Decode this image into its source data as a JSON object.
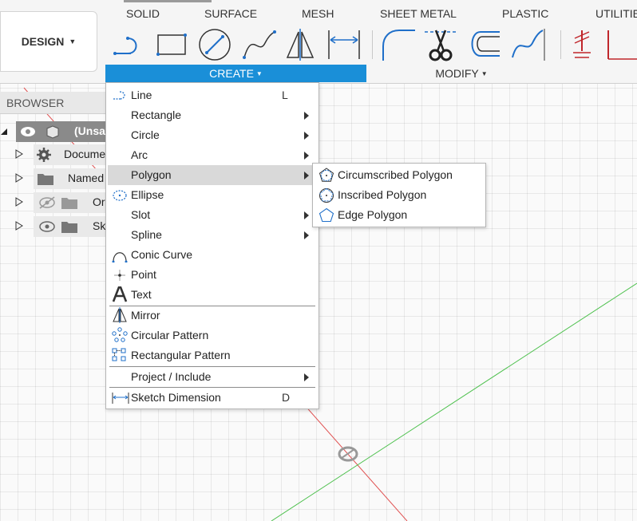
{
  "toolbar": {
    "workspace": "DESIGN",
    "tabs": [
      "SOLID",
      "SURFACE",
      "MESH",
      "SHEET METAL",
      "PLASTIC",
      "UTILITIES"
    ],
    "create_label": "CREATE",
    "modify_label": "MODIFY"
  },
  "browser": {
    "title": "BROWSER",
    "items": [
      {
        "label": "(Unsaved)"
      },
      {
        "label": "Document Settings"
      },
      {
        "label": "Named Views"
      },
      {
        "label": "Origin"
      },
      {
        "label": "Sketches"
      }
    ]
  },
  "create_menu": {
    "items": [
      {
        "label": "Line",
        "shortcut": "L"
      },
      {
        "label": "Rectangle"
      },
      {
        "label": "Circle"
      },
      {
        "label": "Arc"
      },
      {
        "label": "Polygon"
      },
      {
        "label": "Ellipse"
      },
      {
        "label": "Slot"
      },
      {
        "label": "Spline"
      },
      {
        "label": "Conic Curve"
      },
      {
        "label": "Point"
      },
      {
        "label": "Text"
      },
      {
        "label": "Mirror"
      },
      {
        "label": "Circular Pattern"
      },
      {
        "label": "Rectangular Pattern"
      },
      {
        "label": "Project / Include"
      },
      {
        "label": "Sketch Dimension",
        "shortcut": "D"
      }
    ]
  },
  "polygon_submenu": {
    "items": [
      {
        "label": "Circumscribed Polygon"
      },
      {
        "label": "Inscribed Polygon"
      },
      {
        "label": "Edge Polygon"
      }
    ]
  },
  "colors": {
    "accent": "#1a8fd8",
    "sketch_blue": "#1f6fc9",
    "modify_red": "#c0262b",
    "axis_red": "#e05050",
    "axis_green": "#4cc04c"
  }
}
